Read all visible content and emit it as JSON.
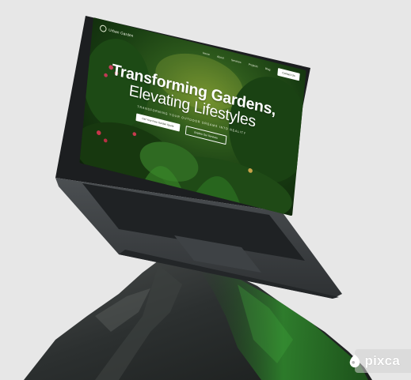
{
  "site": {
    "logo_text": "Urban Garden",
    "nav_links": [
      "Home",
      "About",
      "Services",
      "Projects",
      "Blog"
    ],
    "contact_label": "Contact Us",
    "hero_title_line1": "Transforming Gardens,",
    "hero_title_line2": "Elevating Lifestyles",
    "hero_subtitle": "TRANSFORMING YOUR OUTDOOR DREAMS INTO REALITY",
    "cta_primary": "Get Your Free Garden Quote",
    "cta_secondary": "Explore Our Services"
  },
  "watermark": {
    "text": "pixca",
    "icon": "paint-drop-icon"
  },
  "colors": {
    "background": "#e7e7e7",
    "laptop_body": "#3a3d40",
    "foliage_dark": "#0d2209",
    "foliage_light": "#6c8b2a",
    "rock_moss": "#2f7a2a"
  }
}
